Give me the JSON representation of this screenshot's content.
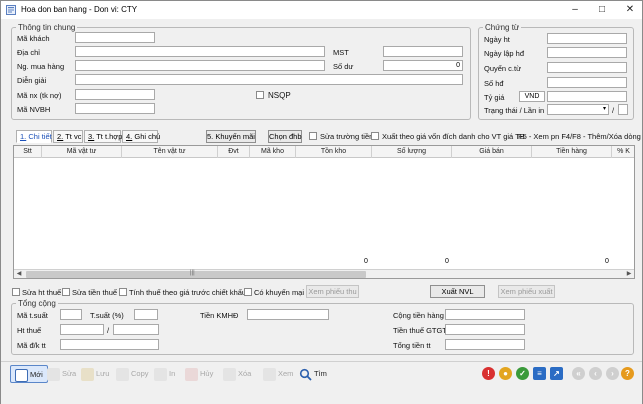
{
  "window": {
    "title": "Hoa don ban hang - Don vi: CTY"
  },
  "general": {
    "legend": "Thông tin chung",
    "ma_khach_label": "Mã khách",
    "dia_chi_label": "Địa chỉ",
    "mst_label": "MST",
    "ng_mua_hang_label": "Ng. mua hàng",
    "so_du_label": "Số dư",
    "so_du_value": "0",
    "dien_giai_label": "Diễn giải",
    "ma_nx_label": "Mã nx (tk nợ)",
    "nsqp_label": "NSQP",
    "ma_nvbh_label": "Mã NVBH"
  },
  "voucher": {
    "legend": "Chứng từ",
    "ngay_ht_label": "Ngày ht",
    "ngay_lap_hd_label": "Ngày lập hđ",
    "quyen_ct_label": "Quyển c.từ",
    "so_hd_label": "Số hđ",
    "ty_gia_label": "Tỷ giá",
    "currency_value": "VND",
    "trang_thai_label": "Trạng thái / Lần in",
    "separator": "/"
  },
  "tabs": [
    {
      "num": "1.",
      "label": "Chi tiết"
    },
    {
      "num": "2.",
      "label": "Tt vc"
    },
    {
      "num": "3.",
      "label": "Tt t.hợp"
    },
    {
      "num": "4.",
      "label": "Ghi chú"
    }
  ],
  "detail_bar": {
    "khuyen_mai_button": "5. Khuyến mãi",
    "chon_dhb_button": "Chọn đhb",
    "sua_truong_tien_label": "Sửa trường tiền",
    "xuat_theo_gia_label": "Xuất theo giá vốn đích danh cho VT giá TB",
    "hint_text": "F5 - Xem pn    F4/F8 - Thêm/Xóa dòng"
  },
  "grid": {
    "columns": [
      "Stt",
      "Mã vật tư",
      "Tên vật tư",
      "Đvt",
      "Mã kho",
      "Tồn kho",
      "Số lượng",
      "Giá bán",
      "Tiền hàng",
      "% K"
    ],
    "footer": {
      "so_luong_total": "0",
      "gia_ban_total": "0",
      "tien_hang_total": "0"
    }
  },
  "options": {
    "sua_ht_thue": "Sửa ht thuế",
    "sua_tien_thue": "Sửa tiền thuế",
    "tinh_thue_label": "Tính thuế theo giá trước chiết khấu",
    "co_khuyen_mai": "Có khuyến mại",
    "xem_phieu_thu_button": "Xem phiếu thu",
    "xuat_nvl_button": "Xuất NVL",
    "xem_phieu_xuat_button": "Xem phiếu xuất"
  },
  "totals": {
    "legend": "Tổng cộng",
    "ma_tsuat_label": "Mã t.suất",
    "tsuat_label": "T.suất (%)",
    "tien_kmhd_label": "Tiền KMHĐ",
    "cong_tien_hang_label": "Cộng tiền hàng",
    "ht_thue_label": "Ht thuế",
    "ht_thue_sep": "/",
    "tien_thue_gtgt_label": "Tiền thuế GTGT",
    "ma_dk_tt_label": "Mã đ/k tt",
    "tong_tien_tt_label": "Tổng tiền tt"
  },
  "toolbar": {
    "moi": "Mới",
    "sua": "Sửa",
    "luu": "Lưu",
    "copy": "Copy",
    "in": "In",
    "huy": "Hủy",
    "xoa": "Xóa",
    "xem": "Xem",
    "tim": "Tìm"
  },
  "colors": {
    "accent": "#1a4fb8",
    "selected_bg": "#dbe8fb"
  }
}
